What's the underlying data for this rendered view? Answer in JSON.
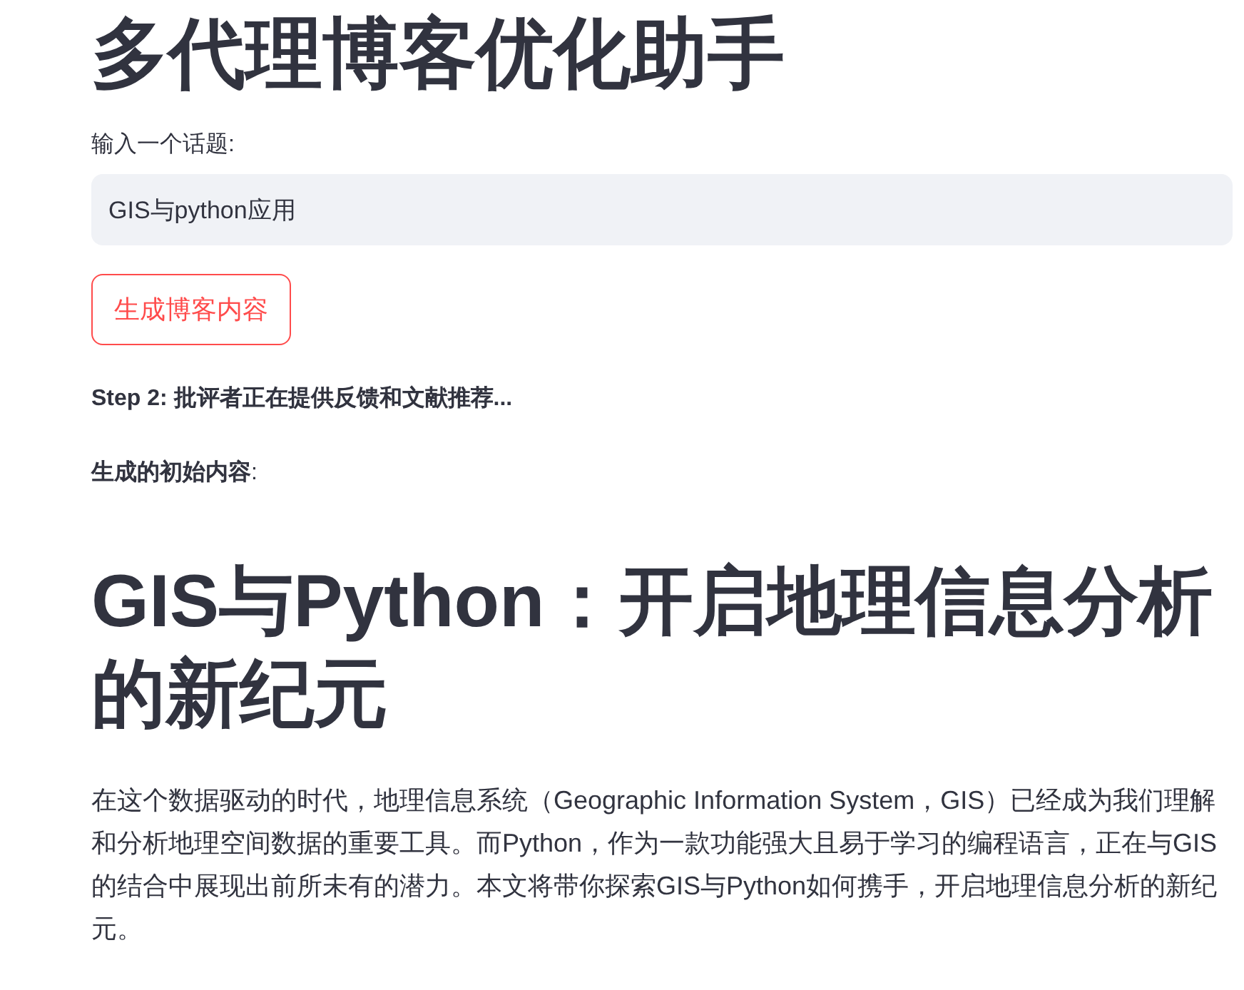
{
  "title": "多代理博客优化助手",
  "topic_input": {
    "label": "输入一个话题:",
    "value": "GIS与python应用"
  },
  "generate_button": {
    "label": "生成博客内容"
  },
  "status": "Step 2: 批评者正在提供反馈和文献推荐...",
  "initial_content_label": "**生成的初始内容**:",
  "article": {
    "heading": "GIS与Python：开启地理信息分析的新纪元",
    "paragraphs": [
      "在这个数据驱动的时代，地理信息系统（Geographic Information System，GIS）已经成为我们理解和分析地理空间数据的重要工具。而Python，作为一款功能强大且易于学习的编程语言，正在与GIS的结合中展现出前所未有的潜力。本文将带你探索GIS与Python如何携手，开启地理信息分析的新纪元。"
    ]
  }
}
